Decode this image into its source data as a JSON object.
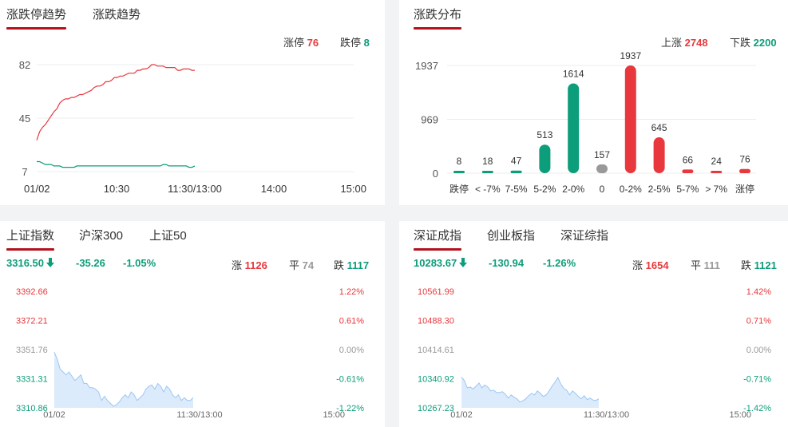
{
  "trend_panel": {
    "tabs": [
      "涨跌停趋势",
      "涨跌趋势"
    ],
    "limit_up_label": "涨停",
    "limit_up_value": "76",
    "limit_down_label": "跌停",
    "limit_down_value": "8"
  },
  "dist_panel": {
    "tab": "涨跌分布",
    "up_label": "上涨",
    "up_value": "2748",
    "down_label": "下跌",
    "down_value": "2200"
  },
  "sh_panel": {
    "tabs": [
      "上证指数",
      "沪深300",
      "上证50"
    ],
    "price": "3316.50",
    "change": "-35.26",
    "pct": "-1.05%",
    "up_label": "涨",
    "up_count": "1126",
    "flat_label": "平",
    "flat_count": "74",
    "down_label": "跌",
    "down_count": "1117"
  },
  "sz_panel": {
    "tabs": [
      "深证成指",
      "创业板指",
      "深证综指"
    ],
    "price": "10283.67",
    "change": "-130.94",
    "pct": "-1.26%",
    "up_label": "涨",
    "up_count": "1654",
    "flat_label": "平",
    "flat_count": "111",
    "down_label": "跌",
    "down_count": "1121"
  },
  "colors": {
    "up": "#e8383d",
    "down": "#0c9d7a",
    "flat": "#999999",
    "tab_underline": "#b3121b",
    "area_fill": "#dcebfb",
    "area_line": "#9cc6f0"
  },
  "chart_data": [
    {
      "type": "line",
      "ylim": [
        7,
        82
      ],
      "y_ticks": [
        "82",
        "45",
        "7"
      ],
      "x_ticks": [
        "01/02",
        "10:30",
        "11:30/13:00",
        "14:00",
        "15:00"
      ],
      "series": [
        {
          "name": "涨停",
          "color": "#e8383d",
          "values": [
            29,
            35,
            38,
            40,
            43,
            46,
            49,
            51,
            55,
            57,
            58,
            58,
            59,
            59,
            60,
            61,
            61,
            62,
            63,
            64,
            66,
            67,
            67,
            68,
            70,
            70,
            71,
            73,
            73,
            74,
            74,
            75,
            76,
            76,
            76,
            78,
            78,
            79,
            79,
            80,
            82,
            82,
            81,
            81,
            81,
            80,
            80,
            80,
            80,
            78,
            78,
            79,
            79,
            79,
            78,
            78
          ]
        },
        {
          "name": "跌停",
          "color": "#0c9d7a",
          "values": [
            14,
            14,
            13,
            12,
            12,
            12,
            11,
            11,
            11,
            10,
            10,
            10,
            10,
            10,
            11,
            11,
            11,
            11,
            11,
            11,
            11,
            11,
            11,
            11,
            11,
            11,
            11,
            11,
            11,
            11,
            11,
            11,
            11,
            11,
            11,
            11,
            11,
            11,
            11,
            11,
            11,
            11,
            11,
            11,
            12,
            12,
            11,
            11,
            11,
            11,
            11,
            11,
            11,
            10,
            10,
            11
          ]
        }
      ]
    },
    {
      "type": "bar",
      "categories": [
        "跌停",
        "< -7%",
        "7-5%",
        "5-2%",
        "2-0%",
        "0",
        "0-2%",
        "2-5%",
        "5-7%",
        "> 7%",
        "涨停"
      ],
      "values": [
        8,
        18,
        47,
        513,
        1614,
        157,
        1937,
        645,
        66,
        24,
        76
      ],
      "bar_colors": [
        "#0c9d7a",
        "#0c9d7a",
        "#0c9d7a",
        "#0c9d7a",
        "#0c9d7a",
        "#999999",
        "#e8383d",
        "#e8383d",
        "#e8383d",
        "#e8383d",
        "#e8383d"
      ],
      "ylim": [
        0,
        1937
      ],
      "y_ticks": [
        "1937",
        "969",
        "0"
      ]
    },
    {
      "type": "area",
      "name": "上证指数",
      "ylim": [
        3310.86,
        3392.66
      ],
      "y_ticks": [
        "3392.66",
        "3372.21",
        "3351.76",
        "3331.31",
        "3310.86"
      ],
      "pct_ticks": [
        "1.22%",
        "0.61%",
        "0.00%",
        "-0.61%",
        "-1.22%"
      ],
      "x_ticks": [
        "01/02",
        "11:30/13:00",
        "15:00"
      ],
      "values": [
        3350,
        3345,
        3338,
        3336,
        3334,
        3336,
        3333,
        3330,
        3332,
        3334,
        3328,
        3328,
        3325,
        3325,
        3324,
        3322,
        3316,
        3319,
        3316,
        3314,
        3312,
        3313,
        3315,
        3318,
        3320,
        3318,
        3322,
        3320,
        3316,
        3318,
        3320,
        3324,
        3326,
        3327,
        3324,
        3328,
        3326,
        3322,
        3326,
        3324,
        3320,
        3318,
        3320,
        3316,
        3318,
        3316,
        3316,
        3318
      ]
    },
    {
      "type": "area",
      "name": "深证成指",
      "ylim": [
        10267.23,
        10561.99
      ],
      "y_ticks": [
        "10561.99",
        "10488.30",
        "10414.61",
        "10340.92",
        "10267.23"
      ],
      "pct_ticks": [
        "1.42%",
        "0.71%",
        "0.00%",
        "-0.71%",
        "-1.42%"
      ],
      "x_ticks": [
        "01/02",
        "11:30/13:00",
        "15:00"
      ],
      "values": [
        10345,
        10336,
        10318,
        10320,
        10315,
        10322,
        10330,
        10318,
        10325,
        10320,
        10310,
        10312,
        10306,
        10306,
        10308,
        10302,
        10292,
        10300,
        10294,
        10290,
        10282,
        10285,
        10290,
        10298,
        10304,
        10300,
        10310,
        10304,
        10296,
        10300,
        10310,
        10322,
        10332,
        10344,
        10328,
        10316,
        10312,
        10300,
        10310,
        10304,
        10296,
        10290,
        10298,
        10288,
        10292,
        10287,
        10286,
        10290
      ]
    }
  ]
}
